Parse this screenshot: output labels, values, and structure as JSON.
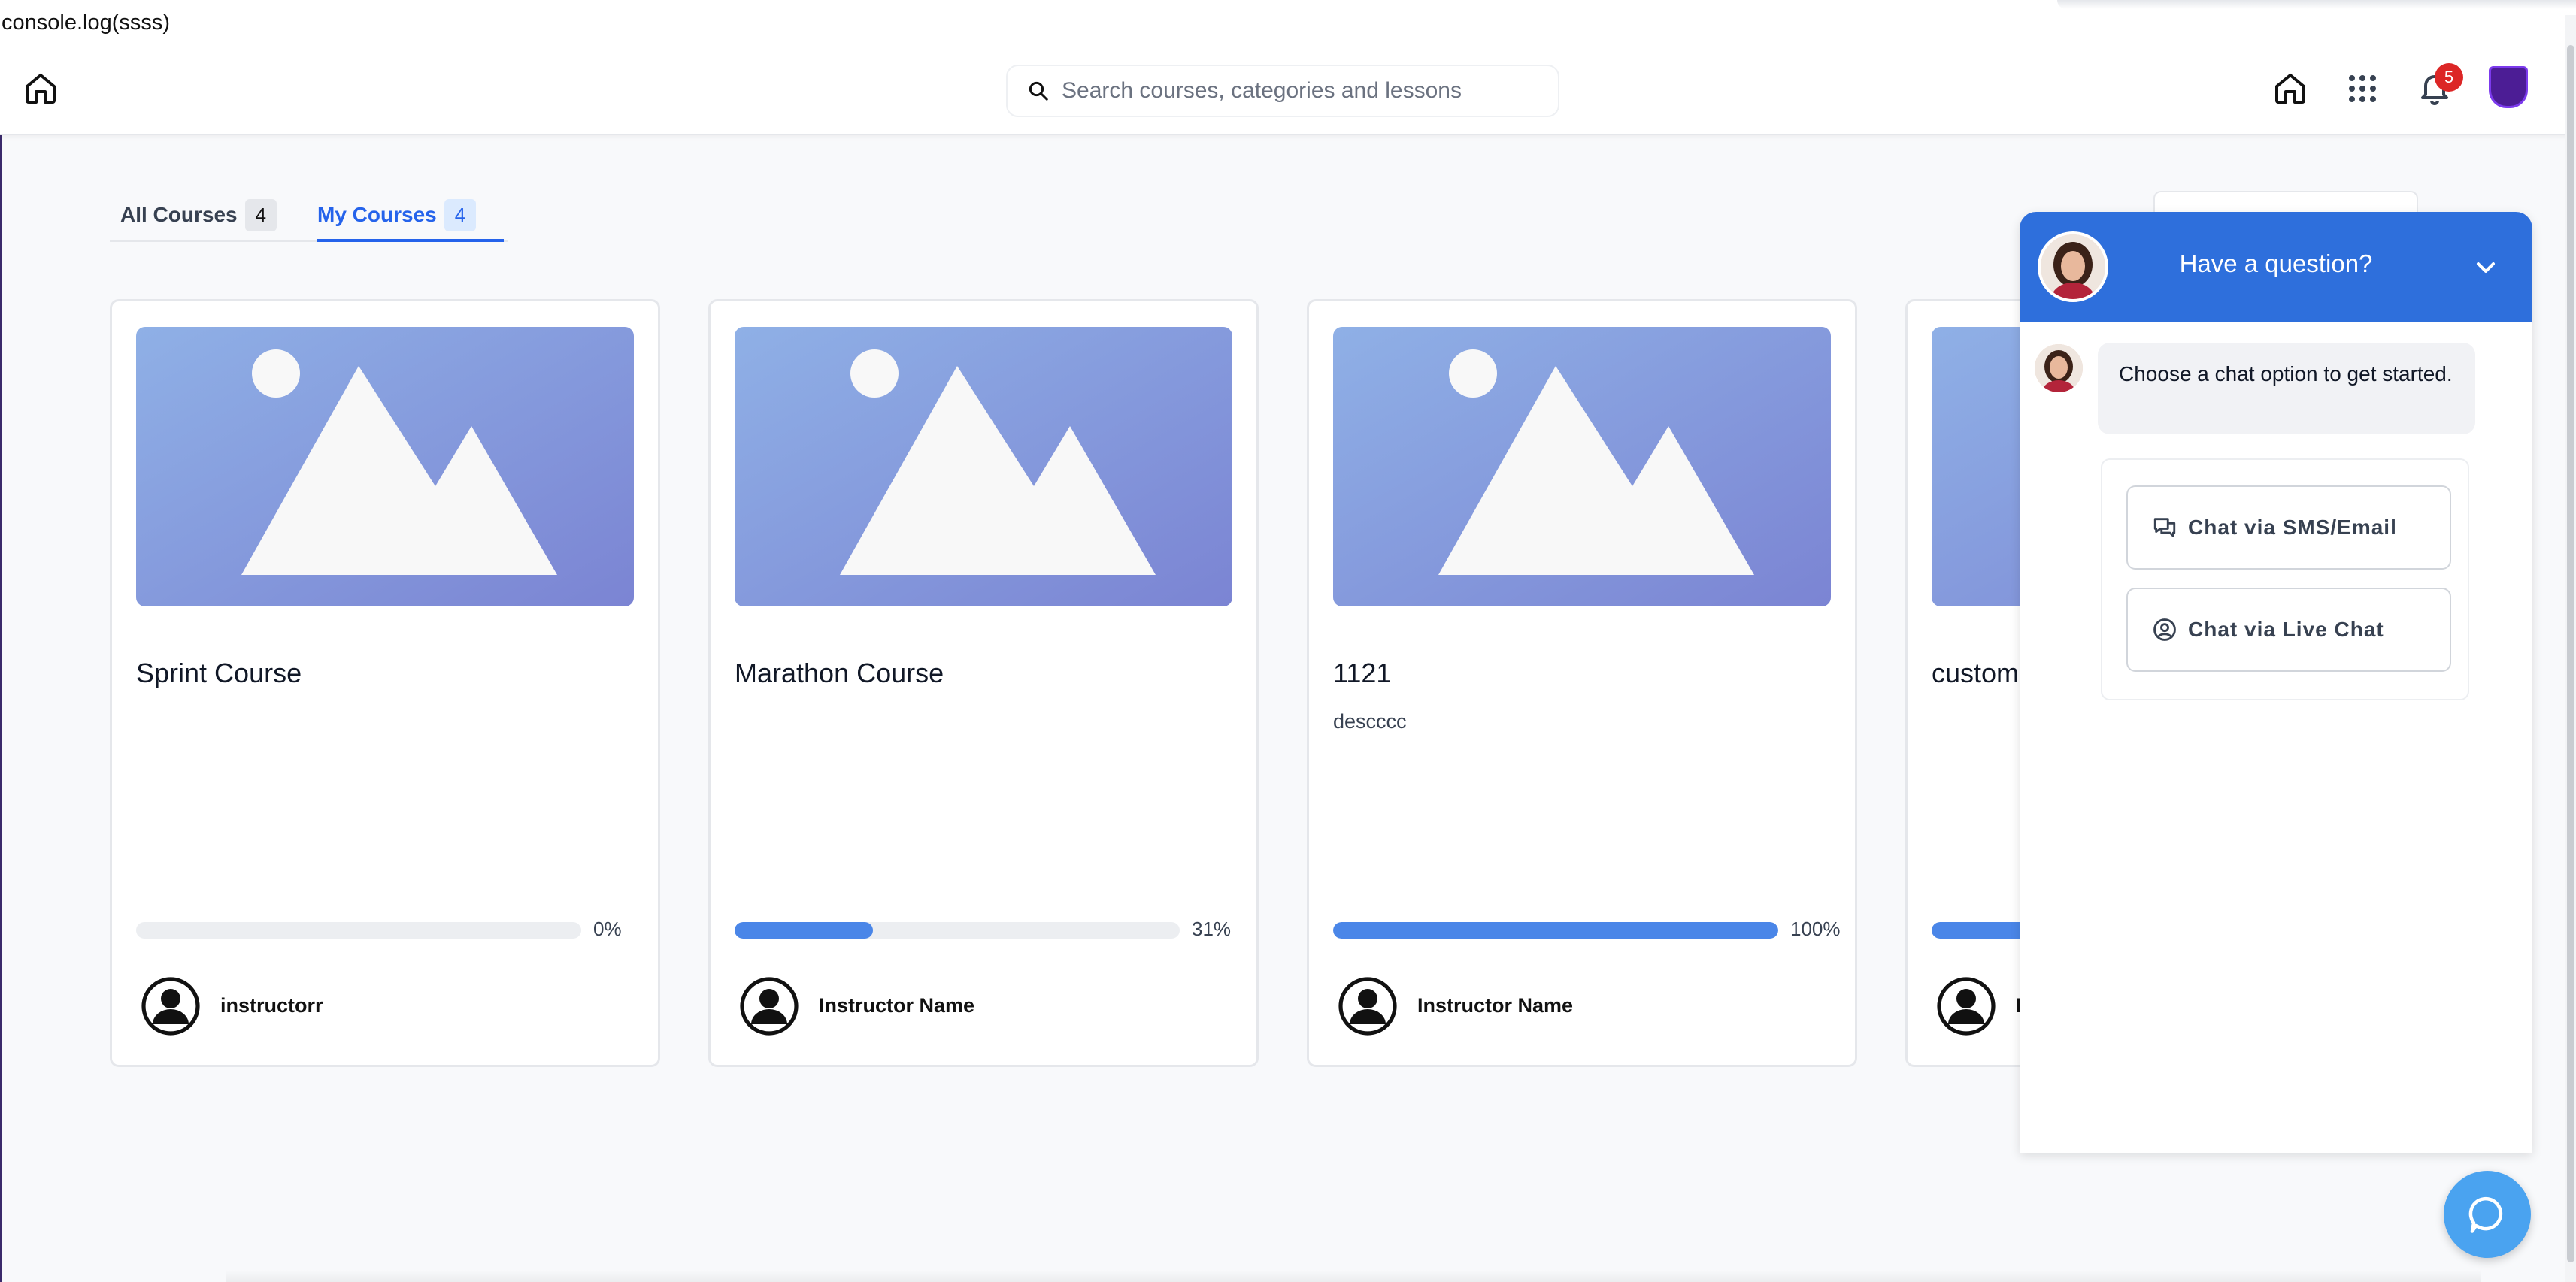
{
  "console": {
    "text": "console.log(ssss)"
  },
  "header": {
    "search_placeholder": "Search courses, categories and lessons",
    "notifications_count": "5",
    "icons": [
      "home-icon",
      "search-icon",
      "apps-grid-icon",
      "bell-icon",
      "school-logo-avatar"
    ]
  },
  "tabs": [
    {
      "label": "All Courses",
      "count": "4",
      "active": false
    },
    {
      "label": "My Courses",
      "count": "4",
      "active": true
    }
  ],
  "courses": [
    {
      "title": "Sprint Course",
      "description": "",
      "progress": 0,
      "progress_label": "0%",
      "instructor": "instructorr"
    },
    {
      "title": "Marathon Course",
      "description": "",
      "progress": 31,
      "progress_label": "31%",
      "instructor": "Instructor Name"
    },
    {
      "title": "1121",
      "description": "descccc",
      "progress": 100,
      "progress_label": "100%",
      "instructor": "Instructor Name"
    },
    {
      "title": "custom",
      "description": "",
      "progress": 100,
      "progress_label": "",
      "instructor": "I"
    }
  ],
  "chat": {
    "header_title": "Have a question?",
    "message": "Choose a chat option to get started.",
    "options": [
      {
        "label": "Chat via SMS/Email",
        "icon": "sms-chat-icon"
      },
      {
        "label": "Chat via Live Chat",
        "icon": "user-circle-icon"
      }
    ]
  },
  "colors": {
    "accent": "#2563eb",
    "chat_header": "#2e6fdc",
    "progress": "#4a86e8",
    "badge": "#dc2626",
    "fab": "#4aa3f0"
  }
}
